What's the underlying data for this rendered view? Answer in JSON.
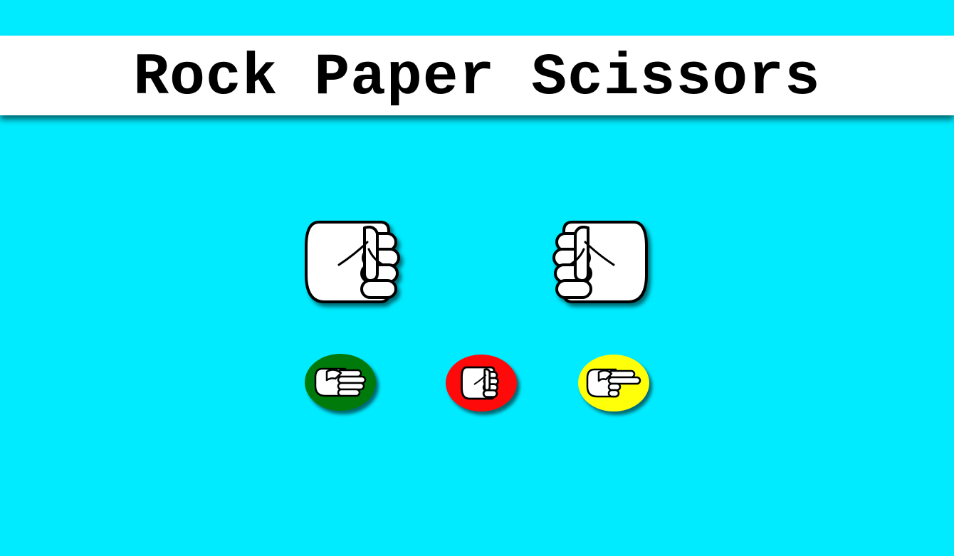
{
  "header": {
    "title": "Rock Paper Scissors"
  },
  "background_color": "#00ebff",
  "players": {
    "left_hand": {
      "choice": "rock",
      "icon": "fist-icon"
    },
    "right_hand": {
      "choice": "rock",
      "icon": "fist-icon"
    }
  },
  "choices": [
    {
      "id": "paper",
      "icon": "flat-hand-icon",
      "color": "#007a0a"
    },
    {
      "id": "rock",
      "icon": "fist-icon",
      "color": "#ff0a0a"
    },
    {
      "id": "scissors",
      "icon": "two-finger-hand-icon",
      "color": "#ffff0a"
    }
  ]
}
